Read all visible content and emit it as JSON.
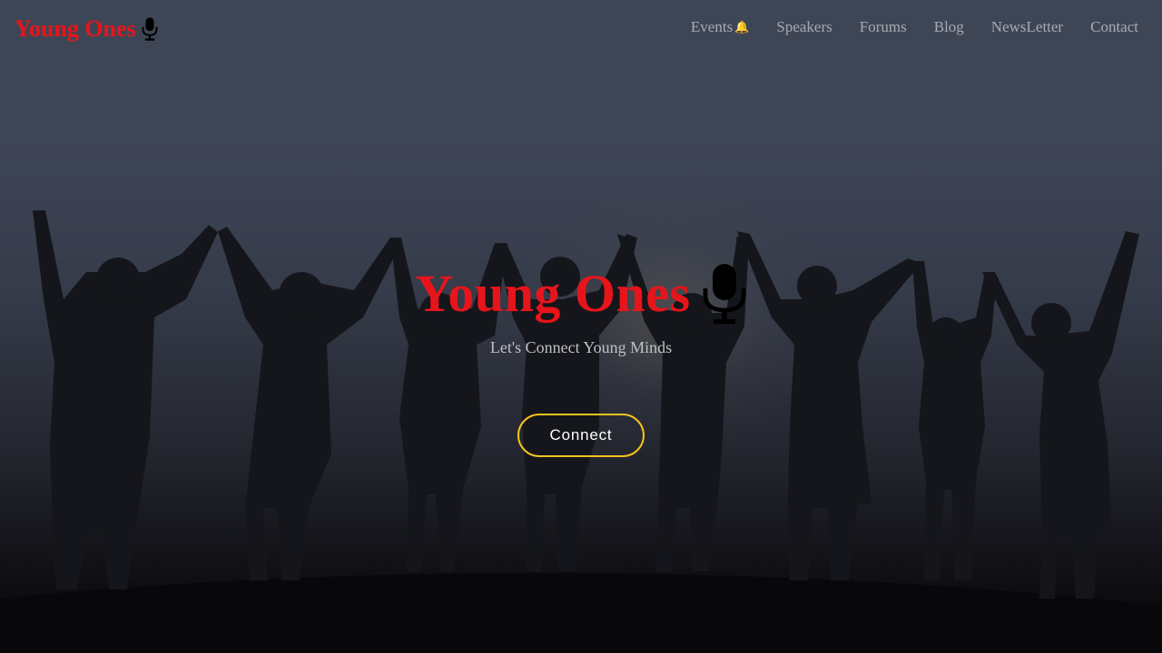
{
  "nav": {
    "brand": "Young Ones",
    "brand_icon": "microphone-icon",
    "brand_color": "#e8141b",
    "items": [
      {
        "label": "Events",
        "icon": "bell-icon"
      },
      {
        "label": "Speakers"
      },
      {
        "label": "Forums"
      },
      {
        "label": "Blog"
      },
      {
        "label": "NewsLetter"
      },
      {
        "label": "Contact"
      }
    ]
  },
  "hero": {
    "title": "Young Ones",
    "title_icon": "microphone-icon",
    "tagline": "Let's Connect Young Minds",
    "cta_label": "Connect",
    "cta_border_color": "#f2c21f",
    "background": "silhouettes-of-people-raising-hands"
  },
  "bell_glyph": "🔔"
}
